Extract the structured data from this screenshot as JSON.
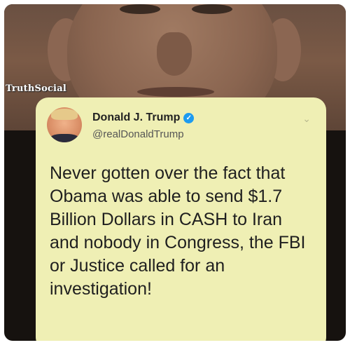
{
  "watermark": "TruthSocial",
  "tweet": {
    "display_name": "Donald J. Trump",
    "handle": "@realDonaldTrump",
    "verified_glyph": "✓",
    "text": "Never gotten over the fact that Obama was able to send $1.7 Billion Dollars in CASH to Iran and nobody in Congress, the FBI or Justice called for an investigation!"
  },
  "icons": {
    "verified": "verified-badge-icon",
    "menu": "chevron-down-icon"
  },
  "colors": {
    "card_background": "#efefb4",
    "verified_blue": "#1d9bf0"
  }
}
